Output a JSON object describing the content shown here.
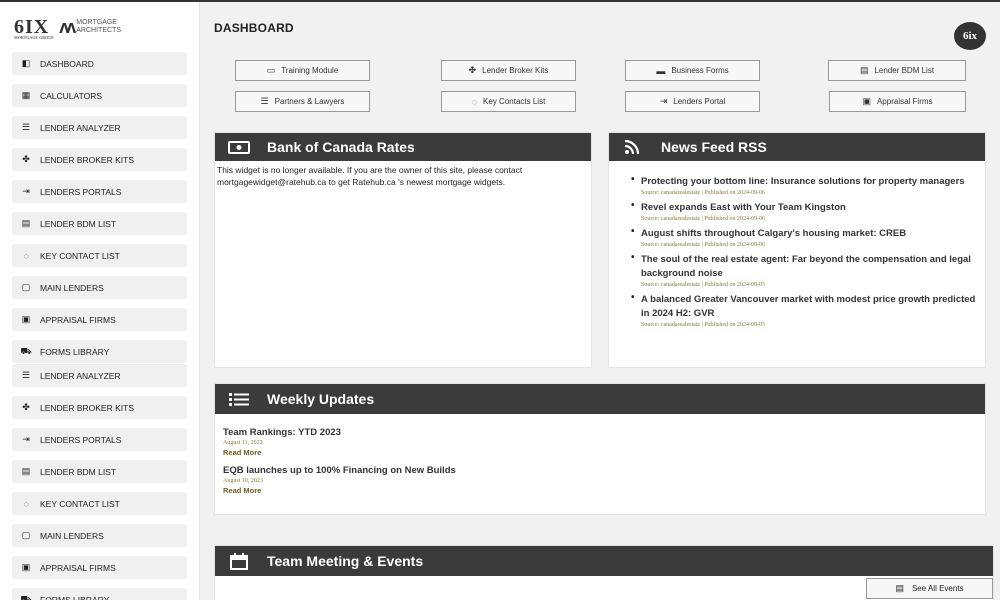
{
  "brand": {
    "logo_text": "6IX",
    "logo_sub": "MORTGAGE GROUP",
    "partner_top": "MORTGAGE",
    "partner_bottom": "ARCHITECTS",
    "badge_text": "6ix"
  },
  "sidebar": {
    "items": [
      {
        "label": "DASHBOARD",
        "icon": "tag-icon"
      },
      {
        "label": "CALCULATORS",
        "icon": "calculator-icon"
      },
      {
        "label": "LENDER ANALYZER",
        "icon": "list-icon"
      },
      {
        "label": "LENDER BROKER KITS",
        "icon": "handshake-icon"
      },
      {
        "label": "LENDERS PORTALS",
        "icon": "portal-icon"
      },
      {
        "label": "LENDER BDM LIST",
        "icon": "card-icon"
      },
      {
        "label": "KEY CONTACT LIST",
        "icon": "contact-icon"
      },
      {
        "label": "MAIN LENDERS",
        "icon": "bookmark-icon"
      },
      {
        "label": "APPRAISAL FIRMS",
        "icon": "appraisal-icon"
      },
      {
        "label": "FORMS LIBRARY",
        "icon": "truck-icon"
      },
      {
        "label": "LENDER ANALYZER",
        "icon": "list-icon"
      },
      {
        "label": "LENDER BROKER KITS",
        "icon": "handshake-icon"
      },
      {
        "label": "LENDERS PORTALS",
        "icon": "portal-icon"
      },
      {
        "label": "LENDER BDM LIST",
        "icon": "card-icon"
      },
      {
        "label": "KEY CONTACT LIST",
        "icon": "contact-icon"
      },
      {
        "label": "MAIN LENDERS",
        "icon": "bookmark-icon"
      },
      {
        "label": "APPRAISAL FIRMS",
        "icon": "appraisal-icon"
      },
      {
        "label": "FORMS LIBRARY",
        "icon": "truck-icon"
      }
    ]
  },
  "page": {
    "title": "DASHBOARD"
  },
  "quick_links": [
    {
      "label": "Training Module",
      "icon": "folder-icon"
    },
    {
      "label": "Lender Broker Kits",
      "icon": "handshake-icon"
    },
    {
      "label": "Business Forms",
      "icon": "briefcase-icon"
    },
    {
      "label": "Lender BDM List",
      "icon": "card-icon"
    },
    {
      "label": "Partners & Lawyers",
      "icon": "list-icon"
    },
    {
      "label": "Key Contacts List",
      "icon": "contact-icon"
    },
    {
      "label": "Lenders Portal",
      "icon": "portal-icon"
    },
    {
      "label": "Appraisal Firms",
      "icon": "appraisal-icon"
    }
  ],
  "bank_rates": {
    "heading": "Bank of Canada Rates",
    "message": "This widget is no longer available. If you are the owner of this site, please contact mortgagewidget@ratehub.ca to get Ratehub.ca 's newest mortgage widgets."
  },
  "news": {
    "heading": "News Feed RSS",
    "items": [
      {
        "title": "Protecting your bottom line: Insurance solutions for property managers",
        "meta": "Source: canadarealestate | Published on 2024-09-06"
      },
      {
        "title": "Revel expands East with Your Team Kingston",
        "meta": "Source: canadarealestate | Published on 2024-09-06"
      },
      {
        "title": "August shifts throughout Calgary's housing market: CREB",
        "meta": "Source: canadarealestate | Published on 2024-09-06"
      },
      {
        "title": "The soul of the real estate agent: Far beyond the compensation and legal background noise",
        "meta": "Source: canadarealestate | Published on 2024-09-05"
      },
      {
        "title": "A balanced Greater Vancouver market with modest price growth predicted in 2024 H2: GVR",
        "meta": "Source: canadarealestate | Published on 2024-09-05"
      }
    ]
  },
  "weekly": {
    "heading": "Weekly Updates",
    "items": [
      {
        "title": "Team Rankings: YTD 2023",
        "date": "August 11, 2023",
        "more": "Read More"
      },
      {
        "title": "EQB launches up to 100% Financing on New Builds",
        "date": "August 10, 2023",
        "more": "Read More"
      }
    ]
  },
  "events": {
    "heading": "Team Meeting & Events",
    "see_all": "See All Events"
  },
  "colors": {
    "header": "#3b3b3b",
    "accent": "#8a7a3a",
    "sidebar_item": "#f0f0f0"
  }
}
